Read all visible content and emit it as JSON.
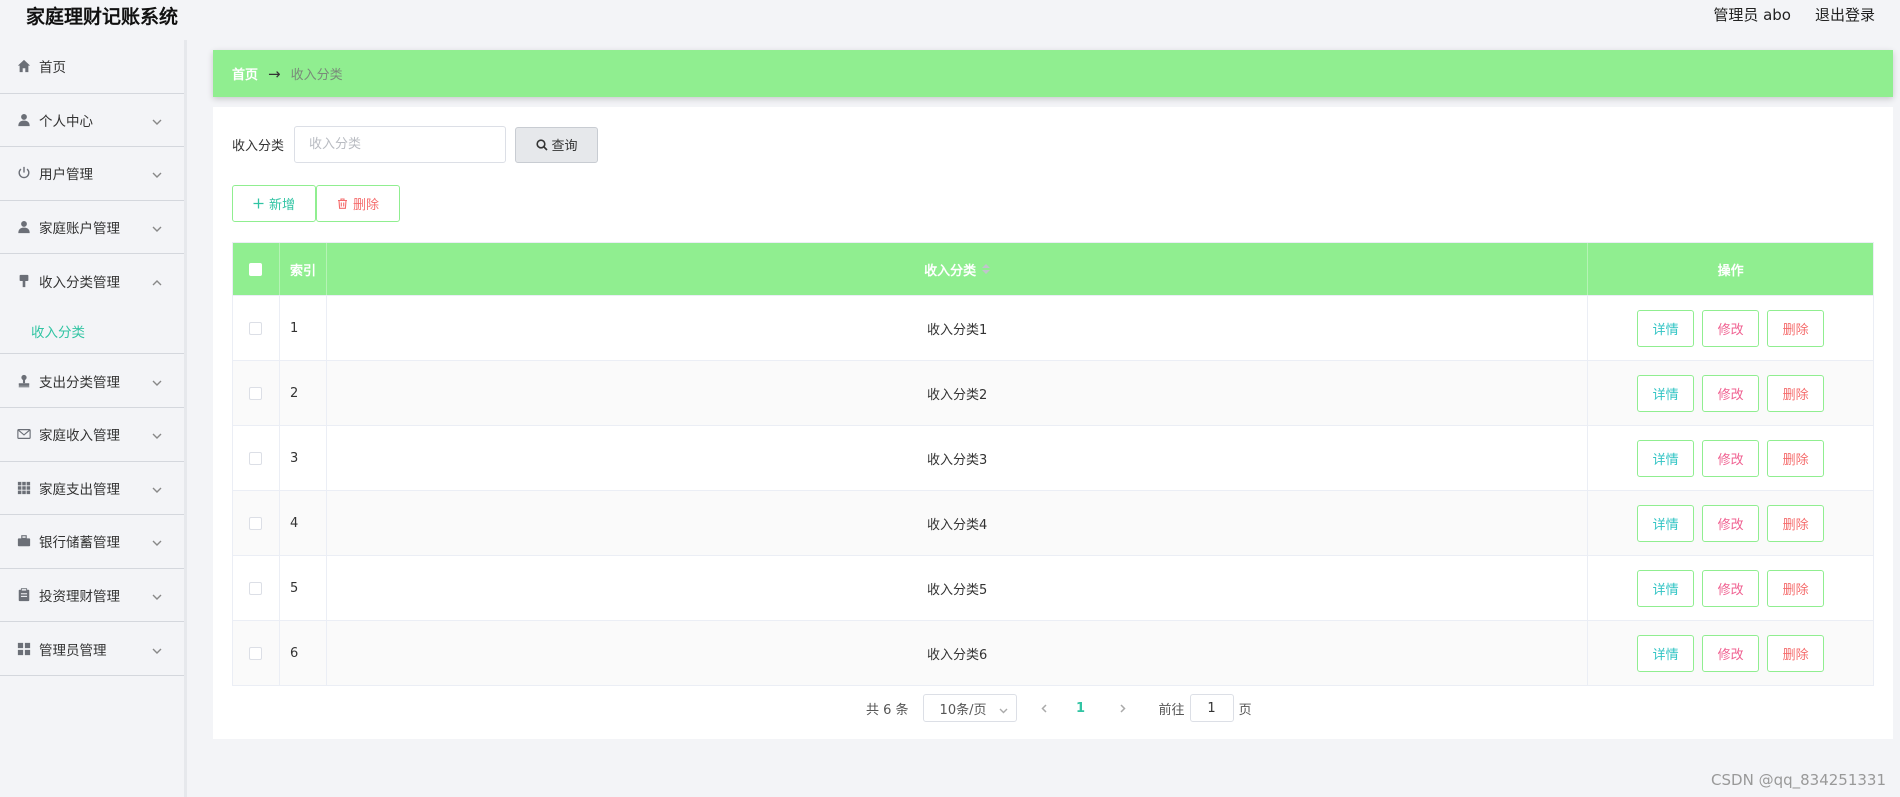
{
  "header": {
    "app_title": "家庭理财记账系统",
    "user_label": "管理员 abo",
    "logout_label": "退出登录"
  },
  "sidebar": {
    "items": [
      {
        "label": "首页",
        "icon": "home-icon"
      },
      {
        "label": "个人中心",
        "icon": "person-icon"
      },
      {
        "label": "用户管理",
        "icon": "power-icon"
      },
      {
        "label": "家庭账户管理",
        "icon": "person-icon"
      },
      {
        "label": "收入分类管理",
        "icon": "brush-icon",
        "expanded": true,
        "children": [
          {
            "label": "收入分类"
          }
        ]
      },
      {
        "label": "支出分类管理",
        "icon": "stamp-icon"
      },
      {
        "label": "家庭收入管理",
        "icon": "mail-icon"
      },
      {
        "label": "家庭支出管理",
        "icon": "grid-icon"
      },
      {
        "label": "银行储蓄管理",
        "icon": "briefcase-icon"
      },
      {
        "label": "投资理财管理",
        "icon": "clipboard-icon"
      },
      {
        "label": "管理员管理",
        "icon": "apps-icon"
      }
    ]
  },
  "breadcrumb": {
    "home": "首页",
    "separator": "→",
    "current": "收入分类"
  },
  "search": {
    "label": "收入分类",
    "placeholder": "收入分类",
    "value": "",
    "button_label": "查询"
  },
  "actions": {
    "add_label": "新增",
    "delete_label": "删除"
  },
  "table": {
    "columns": [
      "索引",
      "收入分类",
      "操作"
    ],
    "rows": [
      {
        "index": "1",
        "name": "收入分类1"
      },
      {
        "index": "2",
        "name": "收入分类2"
      },
      {
        "index": "3",
        "name": "收入分类3"
      },
      {
        "index": "4",
        "name": "收入分类4"
      },
      {
        "index": "5",
        "name": "收入分类5"
      },
      {
        "index": "6",
        "name": "收入分类6"
      }
    ],
    "op_labels": {
      "detail": "详情",
      "edit": "修改",
      "delete": "删除"
    }
  },
  "pagination": {
    "total": "共 6 条",
    "page_size": "10条/页",
    "current_page": "1",
    "goto_prefix": "前往",
    "goto_value": "1",
    "goto_suffix": "页"
  },
  "watermark": "CSDN @qq_834251331",
  "colors": {
    "accent": "#90ee90",
    "link": "#31c4a3",
    "danger": "#f56c6c"
  }
}
